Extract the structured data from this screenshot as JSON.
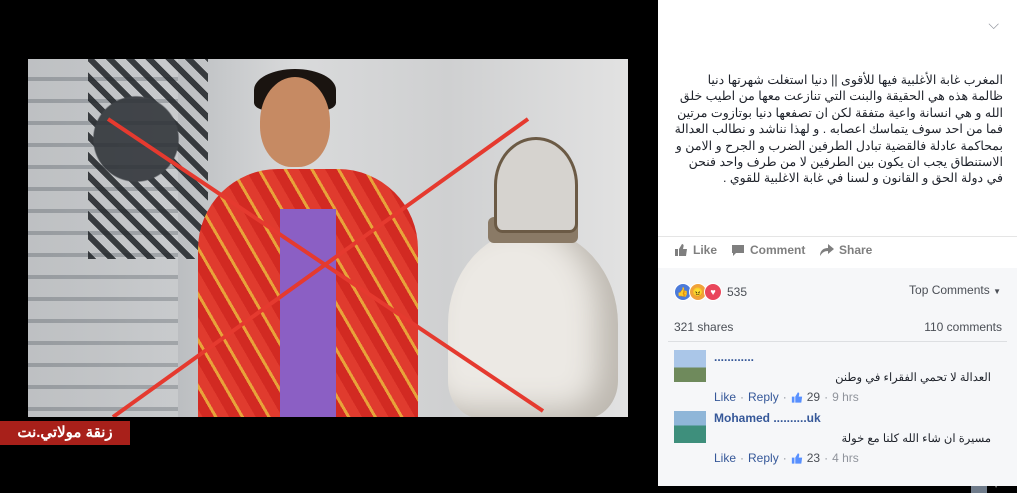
{
  "watermark": {
    "text": "زنقة مولاتي.نت"
  },
  "post": {
    "text": "المغرب غابة الأغلبية فيها للأقوى || دنيا استغلت شهرتها دنيا ظالمة هذه هي الحقيقة والبنت التي تنازعت معها من اطيب خلق الله و هي انسانة واعية متفقة لكن ان تصفعها دنيا بوتازوت مرتين فما من احد سوف يتماسك اعصابه . و لهذا نناشد و نطالب العدالة بمحاكمة عادلة فالقضية تبادل الطرفين الضرب و الجرح و الامن و الاستنطاق يجب ان يكون بين الطرفين لا من طرف واحد فنحن في دولة الحق و القانون و لسنا في غابة الاغلبية للقوي ."
  },
  "actions": {
    "like": "Like",
    "comment": "Comment",
    "share": "Share"
  },
  "reactions": {
    "count": "535",
    "sort_label": "Top Comments"
  },
  "stats": {
    "shares": "321 shares",
    "comments": "110 comments"
  },
  "comments": [
    {
      "name": "............",
      "text": "العدالة لا تحمي الفقراء في وطنن",
      "like": "Like",
      "reply": "Reply",
      "likes": "29",
      "time": "9 hrs"
    },
    {
      "name": "Mohamed ..........uk",
      "text": "مسيرة ان شاء الله كلنا مع خولة",
      "like": "Like",
      "reply": "Reply",
      "likes": "23",
      "time": "4 hrs"
    }
  ],
  "colors": {
    "link": "#365899",
    "cross": "#e53a2f",
    "watermark_bg": "#a8201a"
  },
  "icons": [
    "chevron-down-icon",
    "like-icon",
    "comment-icon",
    "share-icon",
    "reaction-like-icon",
    "reaction-angry-icon",
    "reaction-love-icon"
  ]
}
